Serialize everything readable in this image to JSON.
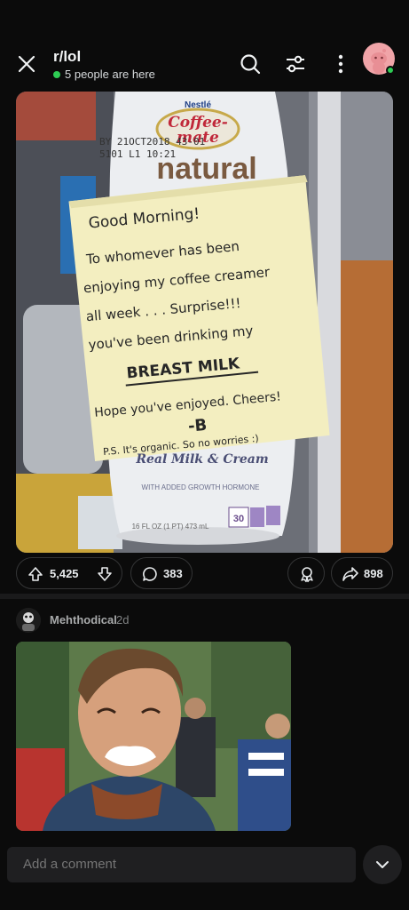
{
  "header": {
    "subreddit": "r/lol",
    "presence_text": "5 people are here",
    "icons": [
      "close-icon",
      "search-icon",
      "filter-icon",
      "more-icon",
      "avatar"
    ]
  },
  "post": {
    "image": {
      "bottle_brand": "Nestlé",
      "bottle_logo_line1": "Coffee-",
      "bottle_logo_line2": "mate",
      "bottle_code1": "BY 21OCT2018 43-01",
      "bottle_code2": "5101 L1  10:21",
      "bottle_word": "natural",
      "bottle_bottom_line1": "Real Milk & Cream",
      "bottle_bottom_line2": "WITH ADDED GROWTH HORMONE",
      "bottle_volume": "16 FL OZ (1 PT) 473 mL",
      "bottle_calories": "30",
      "note_lines": [
        "Good Morning!",
        "To whomever has been",
        "enjoying my coffee creamer",
        "all week . . . Surprise!!!",
        "you've been drinking my",
        "BREAST MILK",
        "Hope you've enjoyed. Cheers!",
        "-B",
        "P.S. It's organic. So no worries :)"
      ]
    },
    "upvotes": "5,425",
    "comments": "383",
    "shares": "898"
  },
  "comment": {
    "author": "Mehthodical",
    "time": "2d"
  },
  "composer": {
    "placeholder": "Add a comment"
  },
  "colors": {
    "background": "#0b0b0b",
    "presence_green": "#2ecc54",
    "pill_border": "#343536",
    "note_paper": "#f3eec0"
  }
}
